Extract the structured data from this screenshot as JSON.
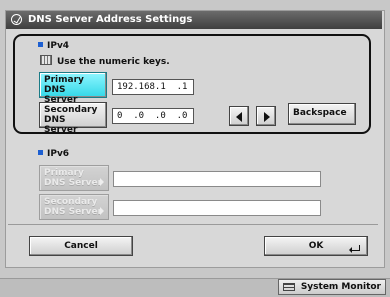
{
  "window": {
    "title": "DNS Server Address Settings",
    "icon": "settings-dial-icon"
  },
  "ipv4": {
    "section_label": "IPv4",
    "hint": "Use the numeric keys.",
    "primary": {
      "label_line1": "Primary",
      "label_line2": "DNS Server",
      "value": "192.168.1  .1",
      "active": true
    },
    "secondary": {
      "label_line1": "Secondary",
      "label_line2": "DNS Server",
      "value": "0  .0  .0  .0"
    },
    "backspace_label": "Backspace"
  },
  "ipv6": {
    "section_label": "IPv6",
    "primary": {
      "label_line1": "Primary",
      "label_line2": "DNS Server",
      "value": ""
    },
    "secondary": {
      "label_line1": "Secondary",
      "label_line2": "DNS Server",
      "value": ""
    }
  },
  "footer": {
    "cancel_label": "Cancel",
    "ok_label": "OK"
  },
  "status": {
    "system_monitor_label": "System Monitor"
  },
  "colors": {
    "accent_cyan": "#33d8e8",
    "bullet_blue": "#1d5fd1",
    "title_bar": "#4a4a4a"
  }
}
